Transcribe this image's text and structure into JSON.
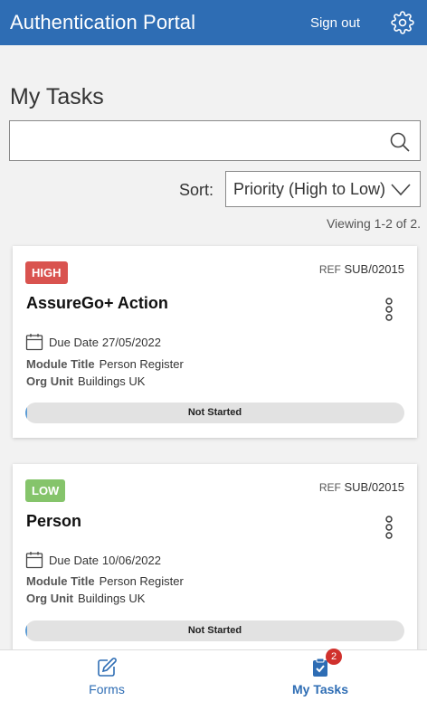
{
  "header": {
    "title": "Authentication Portal",
    "signout_label": "Sign out",
    "color": "#2e6db4"
  },
  "page": {
    "title": "My Tasks",
    "search_value": "",
    "search_placeholder": "",
    "sort_label": "Sort:",
    "sort_value": "Priority (High to Low)",
    "viewing_text": "Viewing 1-2 of 2."
  },
  "tasks": [
    {
      "priority": "HIGH",
      "priority_color": "#d9534f",
      "ref_prefix": "REF",
      "ref": "SUB/02015",
      "title": "AssureGo+ Action",
      "due_label": "Due Date",
      "due_date": "27/05/2022",
      "module_label": "Module Title",
      "module_value": "Person Register",
      "org_label": "Org Unit",
      "org_value": "Buildings UK",
      "status": "Not Started"
    },
    {
      "priority": "LOW",
      "priority_color": "#85c46b",
      "ref_prefix": "REF",
      "ref": "SUB/02015",
      "title": "Person",
      "due_label": "Due Date",
      "due_date": "10/06/2022",
      "module_label": "Module Title",
      "module_value": "Person Register",
      "org_label": "Org Unit",
      "org_value": "Buildings UK",
      "status": "Not Started"
    }
  ],
  "bottom_nav": {
    "forms_label": "Forms",
    "tasks_label": "My Tasks",
    "tasks_count": "2",
    "forms_icon": "edit-icon",
    "tasks_icon": "clipboard-check-icon"
  }
}
